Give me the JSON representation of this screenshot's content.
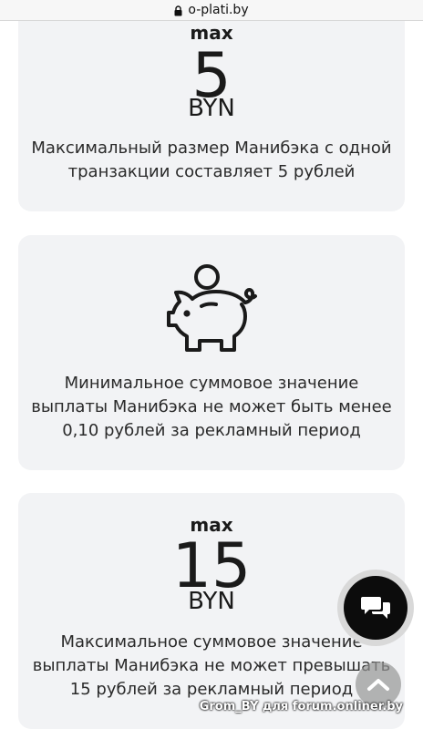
{
  "browser": {
    "url": "o-plati.by"
  },
  "cards": [
    {
      "max_label": "max",
      "value": "5",
      "unit": "BYN",
      "description": "Максимальный размер Манибэка с одной транзакции составляет 5 рублей"
    },
    {
      "icon": "piggy-bank-icon",
      "description": "Минимальное суммовое значение выплаты Манибэка не может быть менее 0,10 рублей за рекламный период"
    },
    {
      "max_label": "max",
      "value": "15",
      "unit": "BYN",
      "description": "Максимальное суммовое значение выплаты Манибэка не может превышать 15 рублей за рекламный период"
    }
  ],
  "widgets": {
    "chat_icon": "chat-bubbles-icon",
    "scroll_top_icon": "chevron-up-icon"
  },
  "watermark": "Grom_BY для forum.onliner.by"
}
